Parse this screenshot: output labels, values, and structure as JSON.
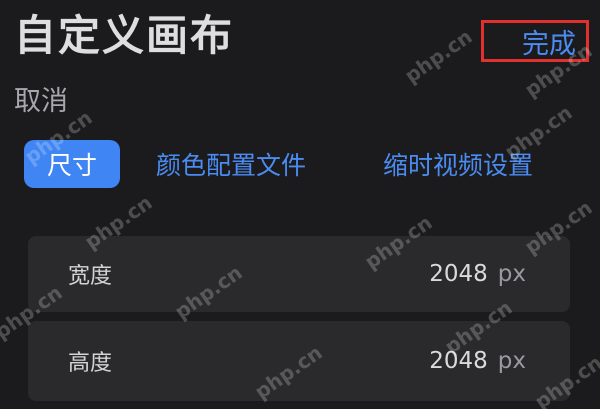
{
  "header": {
    "title": "自定义画布",
    "done_label": "完成",
    "cancel_label": "取消"
  },
  "tabs": [
    {
      "label": "尺寸",
      "active": true
    },
    {
      "label": "颜色配置文件",
      "active": false
    },
    {
      "label": "缩时视频设置",
      "active": false
    }
  ],
  "settings": {
    "width": {
      "label": "宽度",
      "value": "2048",
      "unit": "px"
    },
    "height": {
      "label": "高度",
      "value": "2048",
      "unit": "px"
    }
  },
  "watermark": {
    "text": "php.cn"
  },
  "colors": {
    "background": "#1b1b1d",
    "accent": "#3f86f4",
    "link": "#4a8cf2",
    "card": "#2a2a2c",
    "highlight_border": "#e0312f"
  }
}
